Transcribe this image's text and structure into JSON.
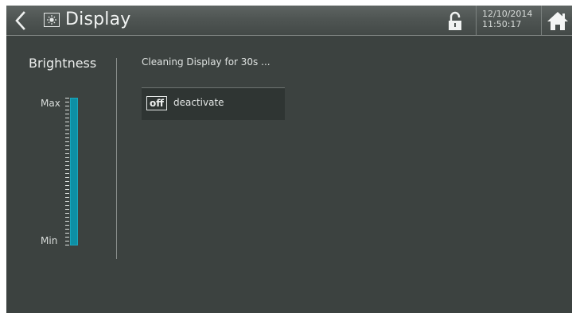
{
  "header": {
    "title": "Display",
    "date": "12/10/2014",
    "time": "11:50:17",
    "icons": {
      "back": "chevron-left-icon",
      "title": "display-brightness-icon",
      "lock": "unlocked-padlock-icon",
      "home": "home-icon"
    }
  },
  "brightness": {
    "title": "Brightness",
    "max_label": "Max",
    "min_label": "Min",
    "level": 1.0
  },
  "content": {
    "cleaning_text": "Cleaning Display for 30s ...",
    "deactivate_badge": "off",
    "deactivate_label": "deactivate"
  },
  "colors": {
    "background": "#3c4240",
    "header": "#4f5553",
    "slider_accent": "#0d8fa5",
    "text": "#e9ecec"
  }
}
